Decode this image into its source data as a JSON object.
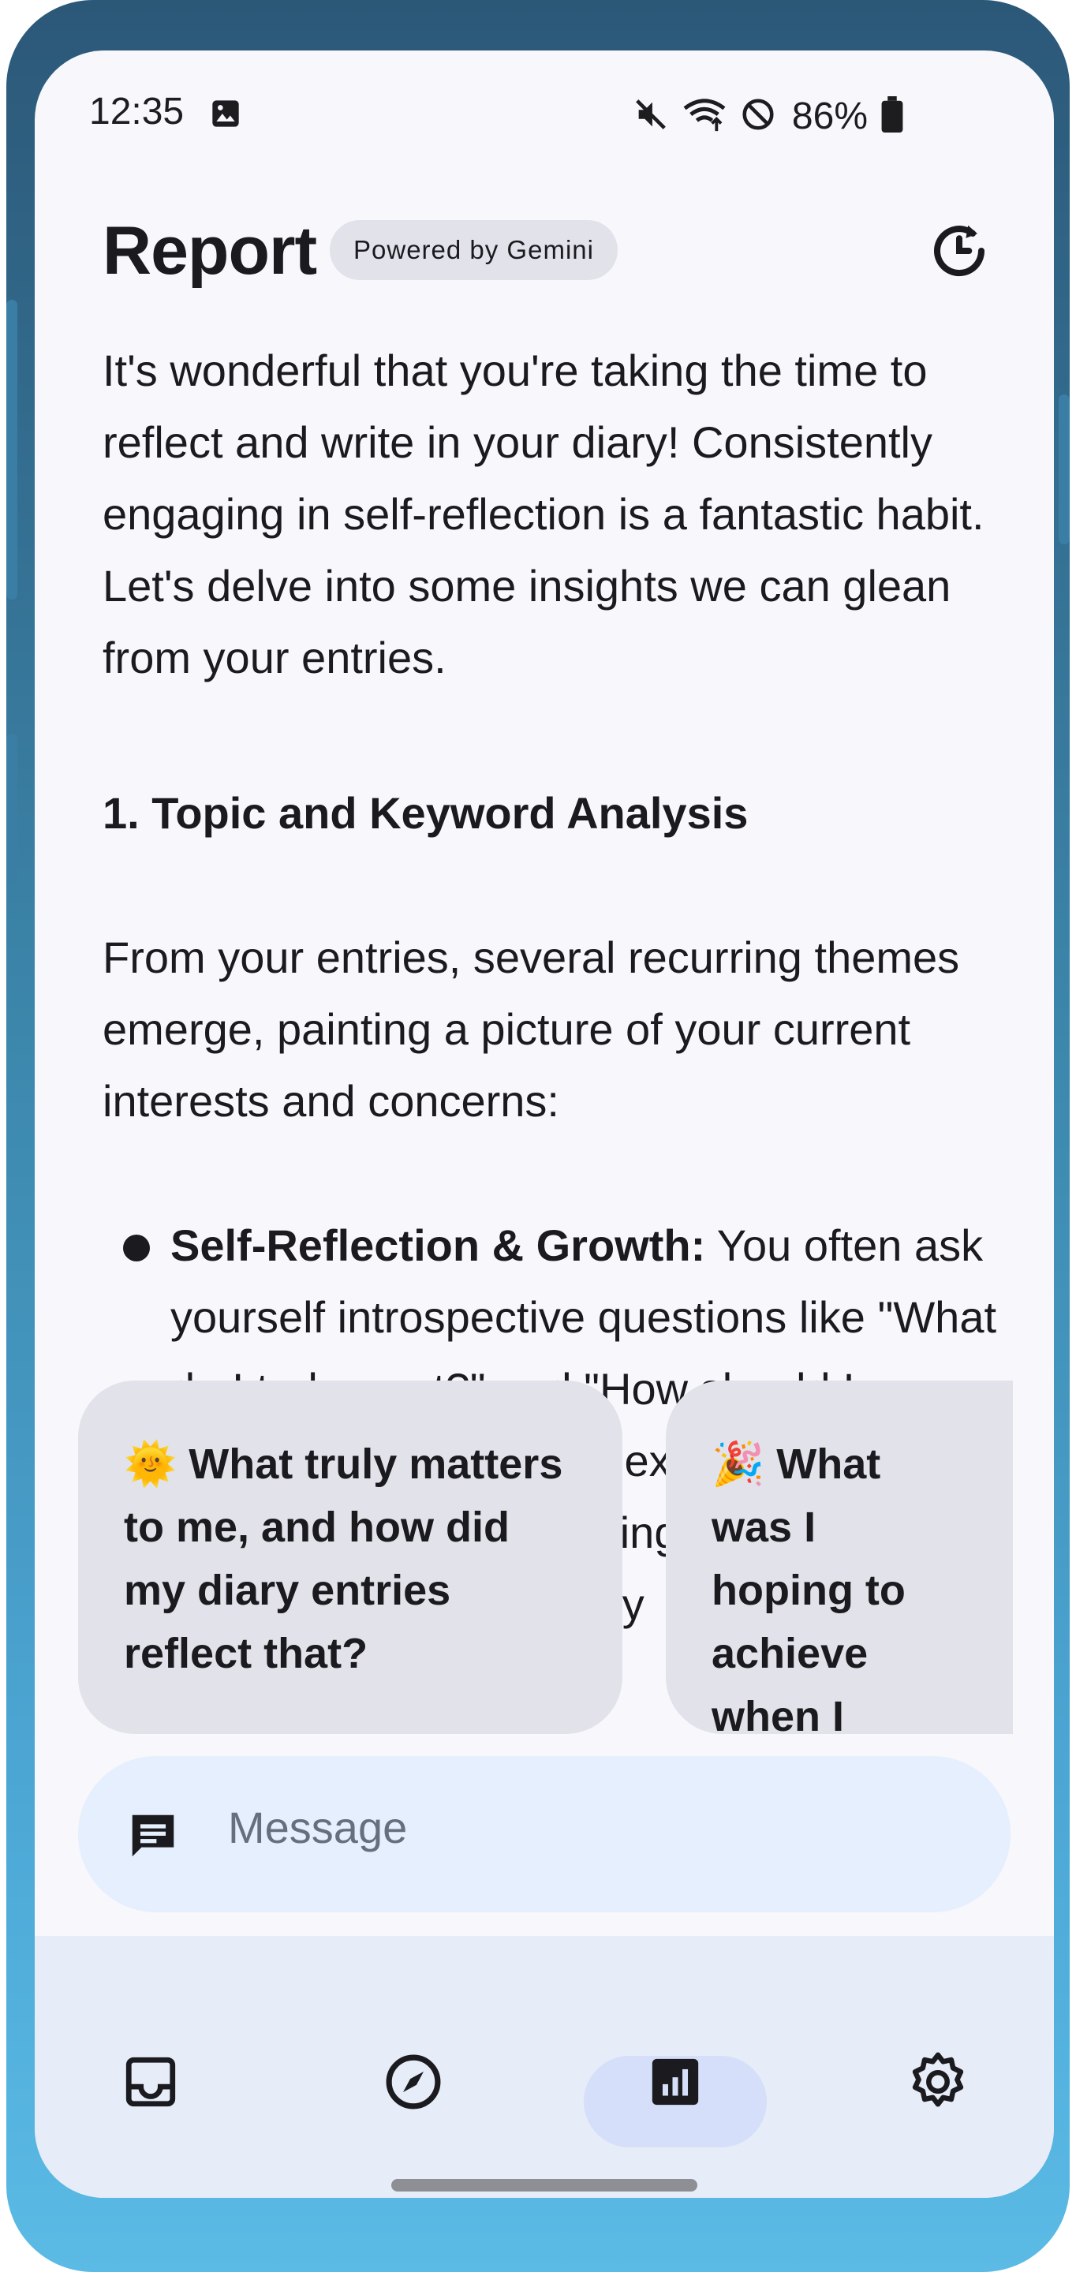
{
  "status_bar": {
    "time": "12:35",
    "battery": "86%",
    "icons": [
      "image-icon",
      "mute-icon",
      "wifi-icon",
      "do-not-disturb-icon",
      "battery-icon"
    ]
  },
  "header": {
    "title": "Report",
    "badge": "Powered by Gemini",
    "history_icon": "history-icon"
  },
  "report": {
    "intro": "It's wonderful that you're taking the time to reflect and write in your diary! Consistently engaging in self-reflection is a fantastic habit. Let's delve into some insights we can glean from your entries.",
    "section_heading": "1. Topic and Keyword Analysis",
    "section_intro": "From your entries, several recurring themes emerge, painting a picture of your current interests and concerns:",
    "bullet_label": "Self-Reflection & Growth:",
    "bullet_text": " You often ask yourself introspective questions like \"What do I truly want?\" and \"How should I grow?\". You're open to examining your behaviour, acknowledging the complexity of emotions and actively"
  },
  "suggestions": [
    {
      "emoji": "🌞",
      "text": "What truly matters to me, and how did my diary entries reflect that?"
    },
    {
      "emoji": "🎉",
      "text": "What was I hoping to achieve when I started writing in my diary?"
    }
  ],
  "message_bar": {
    "placeholder": "Message",
    "icon": "message-icon"
  },
  "bottom_nav": {
    "items": [
      {
        "name": "inbox",
        "icon": "inbox-icon"
      },
      {
        "name": "explore",
        "icon": "compass-icon"
      },
      {
        "name": "report",
        "icon": "bar-chart-icon",
        "active": true
      },
      {
        "name": "settings",
        "icon": "gear-icon"
      }
    ]
  }
}
